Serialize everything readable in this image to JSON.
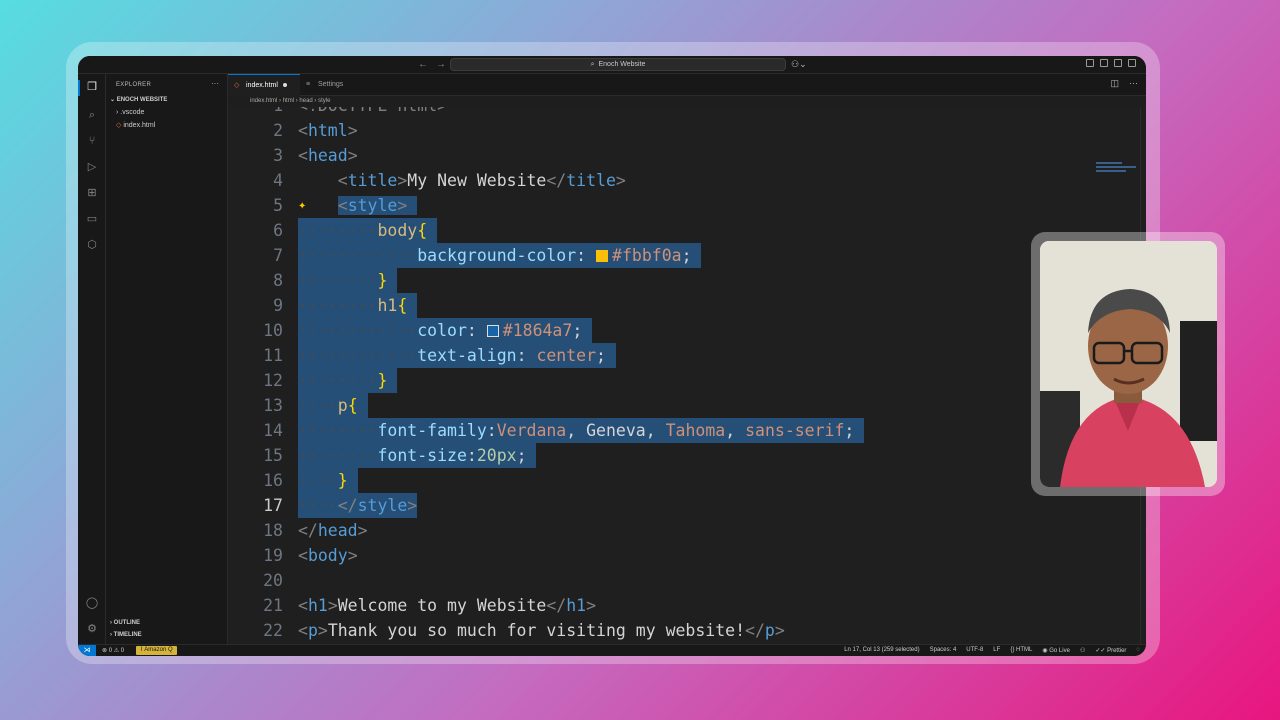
{
  "titlebar": {
    "search_text": "Enoch Website"
  },
  "sidebar": {
    "title": "EXPLORER",
    "more": "···",
    "folder": "ENOCH WEBSITE",
    "items": [
      ".vscode",
      "index.html"
    ],
    "outline": "OUTLINE",
    "timeline": "TIMELINE"
  },
  "tabs": [
    {
      "label": "index.html",
      "active": true,
      "modified": true
    },
    {
      "label": "Settings",
      "active": false
    }
  ],
  "breadcrumb": [
    "index.html",
    "html",
    "head",
    "style"
  ],
  "editor": {
    "current_line": 17,
    "first_line_partial": "<!DOCTYPE html>"
  },
  "status": {
    "errors": "0",
    "warnings": "0",
    "amazon_q": "Amazon Q",
    "position": "Ln 17, Col 13 (259 selected)",
    "spaces": "Spaces: 4",
    "encoding": "UTF-8",
    "eol": "LF",
    "language": "HTML",
    "go_live": "Go Live",
    "prettier": "Prettier"
  },
  "colors": {
    "accent": "#0078d4",
    "selection": "#264f78",
    "swatch_background": "#fbbf0a",
    "swatch_color": "#1864a7"
  }
}
